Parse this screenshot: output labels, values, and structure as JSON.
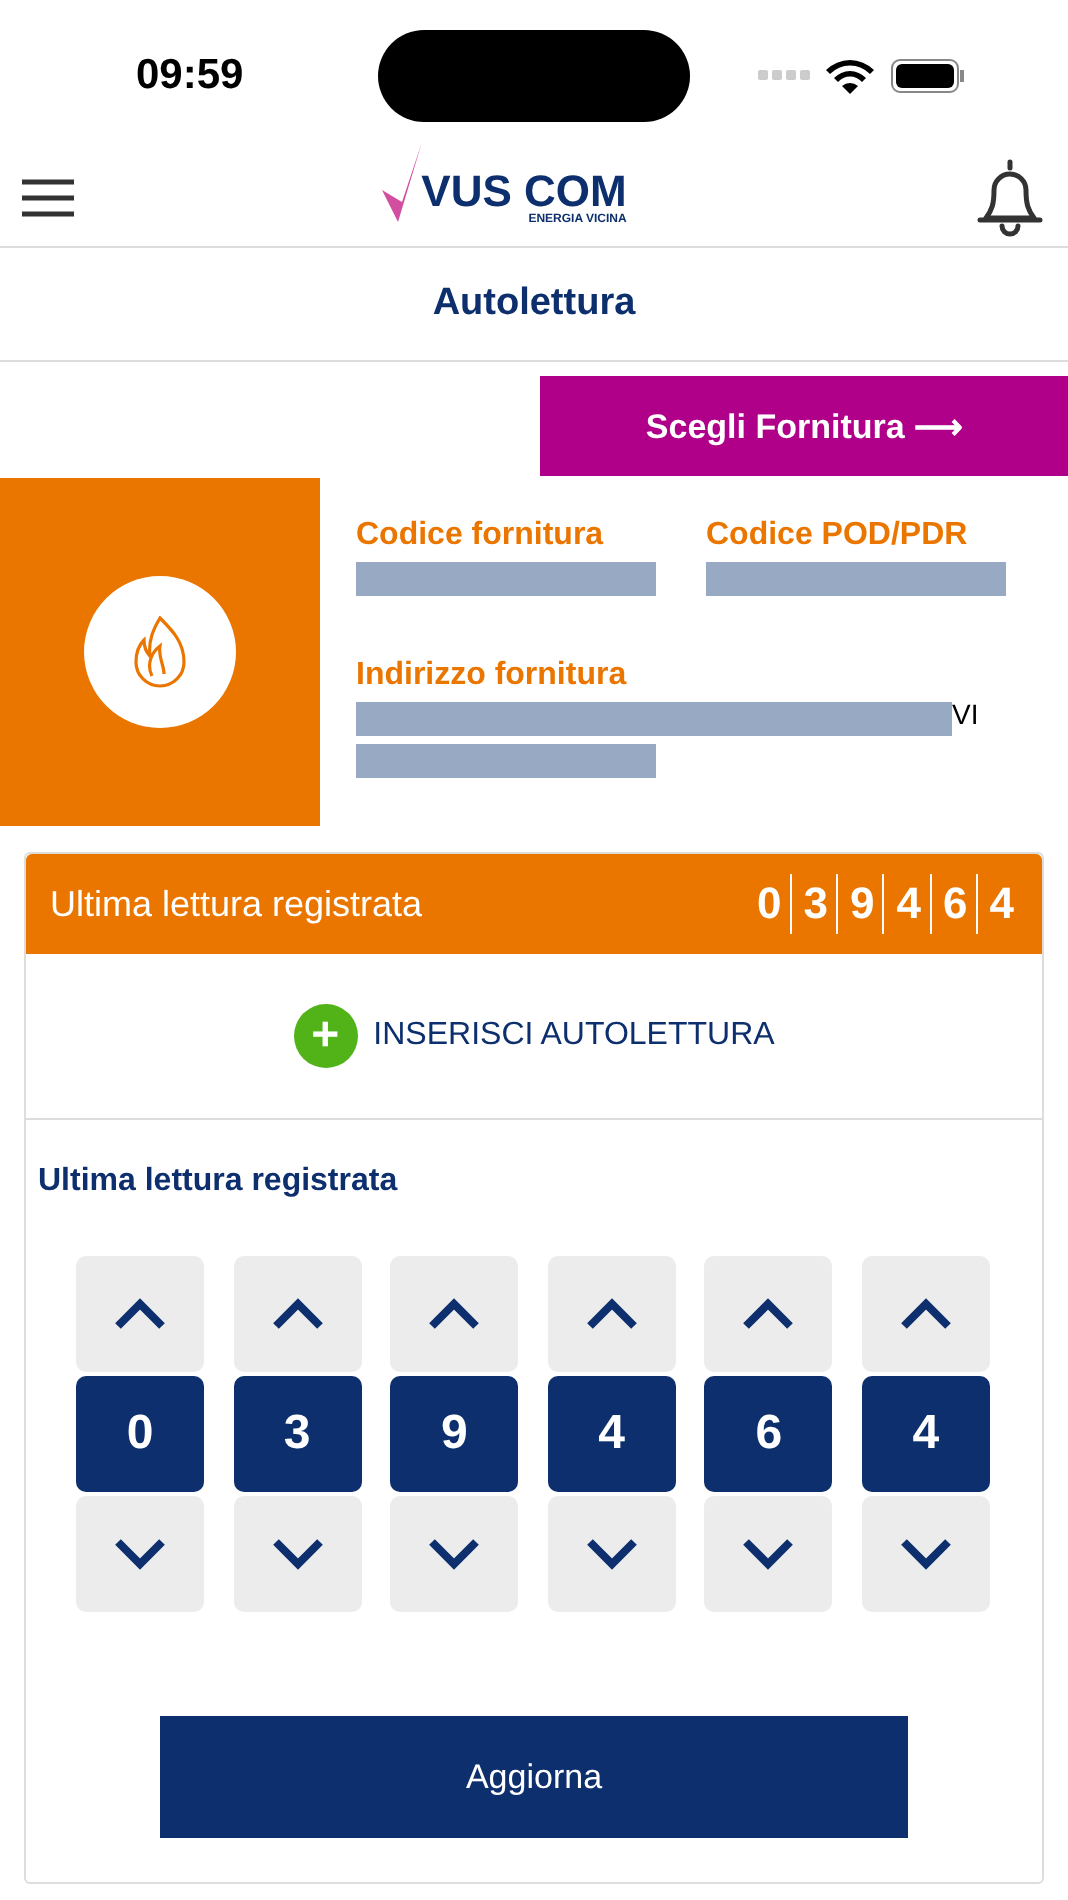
{
  "status_bar": {
    "time": "09:59"
  },
  "header": {
    "logo": "VUS COM",
    "logo_tagline": "ENERGIA VICINA"
  },
  "page_title": "Autolettura",
  "choose_button": {
    "label": "Scegli Fornitura",
    "arrow": "⟶"
  },
  "supply": {
    "fields": [
      {
        "label": "Codice fornitura",
        "redacted": true
      },
      {
        "label": "Codice POD/PDR",
        "redacted": true
      },
      {
        "label": "Indirizzo fornitura",
        "redacted": true,
        "visible_end": "VI",
        "wraps": true
      }
    ]
  },
  "last_reading": {
    "label": "Ultima lettura registrata",
    "digits": [
      "0",
      "3",
      "9",
      "4",
      "6",
      "4"
    ]
  },
  "insert_button": {
    "icon": "+",
    "label": "INSERISCI AUTOLETTURA"
  },
  "counter": {
    "title": "Ultima lettura registrata",
    "digits": [
      "0",
      "3",
      "9",
      "4",
      "6",
      "4"
    ]
  },
  "update_button": {
    "label": "Aggiorna"
  }
}
